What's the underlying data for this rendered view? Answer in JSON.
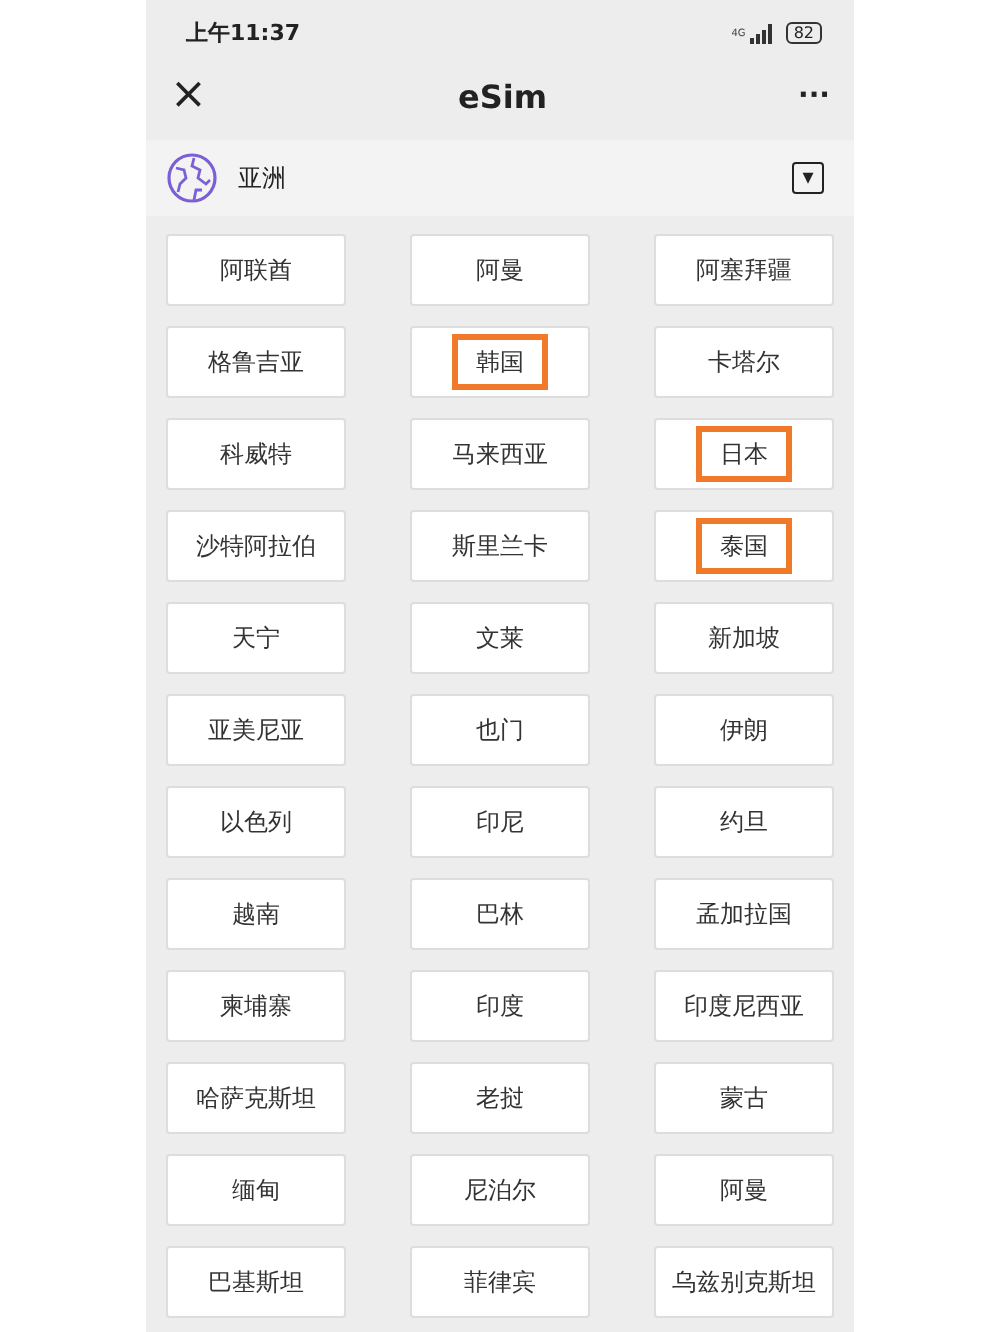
{
  "status_bar": {
    "time": "上午11:37",
    "network": "4G",
    "battery": "82"
  },
  "nav": {
    "close": "×",
    "title": "eSim",
    "more": "···"
  },
  "region": {
    "name": "亚洲",
    "dropdown": "▾"
  },
  "countries": [
    {
      "name": "阿联酋",
      "highlighted": false
    },
    {
      "name": "阿曼",
      "highlighted": false
    },
    {
      "name": "阿塞拜疆",
      "highlighted": false
    },
    {
      "name": "格鲁吉亚",
      "highlighted": false
    },
    {
      "name": "韩国",
      "highlighted": true
    },
    {
      "name": "卡塔尔",
      "highlighted": false
    },
    {
      "name": "科威特",
      "highlighted": false
    },
    {
      "name": "马来西亚",
      "highlighted": false
    },
    {
      "name": "日本",
      "highlighted": true
    },
    {
      "name": "沙特阿拉伯",
      "highlighted": false
    },
    {
      "name": "斯里兰卡",
      "highlighted": false
    },
    {
      "name": "泰国",
      "highlighted": true
    },
    {
      "name": "天宁",
      "highlighted": false
    },
    {
      "name": "文莱",
      "highlighted": false
    },
    {
      "name": "新加坡",
      "highlighted": false
    },
    {
      "name": "亚美尼亚",
      "highlighted": false
    },
    {
      "name": "也门",
      "highlighted": false
    },
    {
      "name": "伊朗",
      "highlighted": false
    },
    {
      "name": "以色列",
      "highlighted": false
    },
    {
      "name": "印尼",
      "highlighted": false
    },
    {
      "name": "约旦",
      "highlighted": false
    },
    {
      "name": "越南",
      "highlighted": false
    },
    {
      "name": "巴林",
      "highlighted": false
    },
    {
      "name": "孟加拉国",
      "highlighted": false
    },
    {
      "name": "柬埔寨",
      "highlighted": false
    },
    {
      "name": "印度",
      "highlighted": false
    },
    {
      "name": "印度尼西亚",
      "highlighted": false
    },
    {
      "name": "哈萨克斯坦",
      "highlighted": false
    },
    {
      "name": "老挝",
      "highlighted": false
    },
    {
      "name": "蒙古",
      "highlighted": false
    },
    {
      "name": "缅甸",
      "highlighted": false
    },
    {
      "name": "尼泊尔",
      "highlighted": false
    },
    {
      "name": "阿曼",
      "highlighted": false
    },
    {
      "name": "巴基斯坦",
      "highlighted": false
    },
    {
      "name": "菲律宾",
      "highlighted": false
    },
    {
      "name": "乌兹别克斯坦",
      "highlighted": false
    }
  ]
}
